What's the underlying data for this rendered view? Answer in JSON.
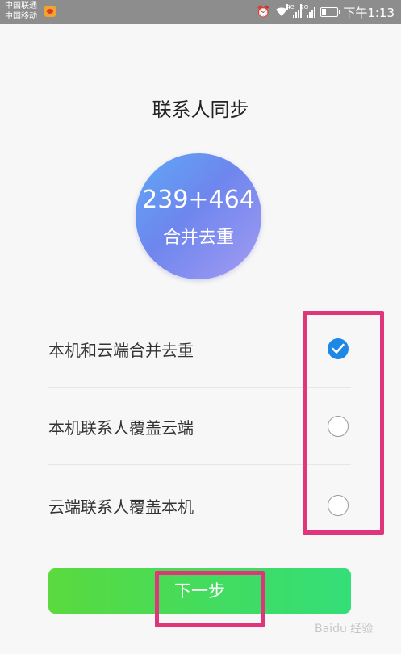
{
  "status_bar": {
    "carrier1": "中国联通",
    "carrier2": "中国移动",
    "network1": "4G",
    "network2": "2G",
    "time": "下午1:13"
  },
  "page": {
    "title": "联系人同步",
    "circle_value": "239+464",
    "circle_label": "合并去重"
  },
  "options": [
    {
      "label": "本机和云端合并去重",
      "selected": true
    },
    {
      "label": "本机联系人覆盖云端",
      "selected": false
    },
    {
      "label": "云端联系人覆盖本机",
      "selected": false
    }
  ],
  "next_button": {
    "label": "下一步"
  },
  "watermark": "Baidu 经验",
  "colors": {
    "accent": "#1e88e5",
    "button_start": "#5ada3e",
    "button_end": "#34de78",
    "highlight": "#e0357a"
  }
}
